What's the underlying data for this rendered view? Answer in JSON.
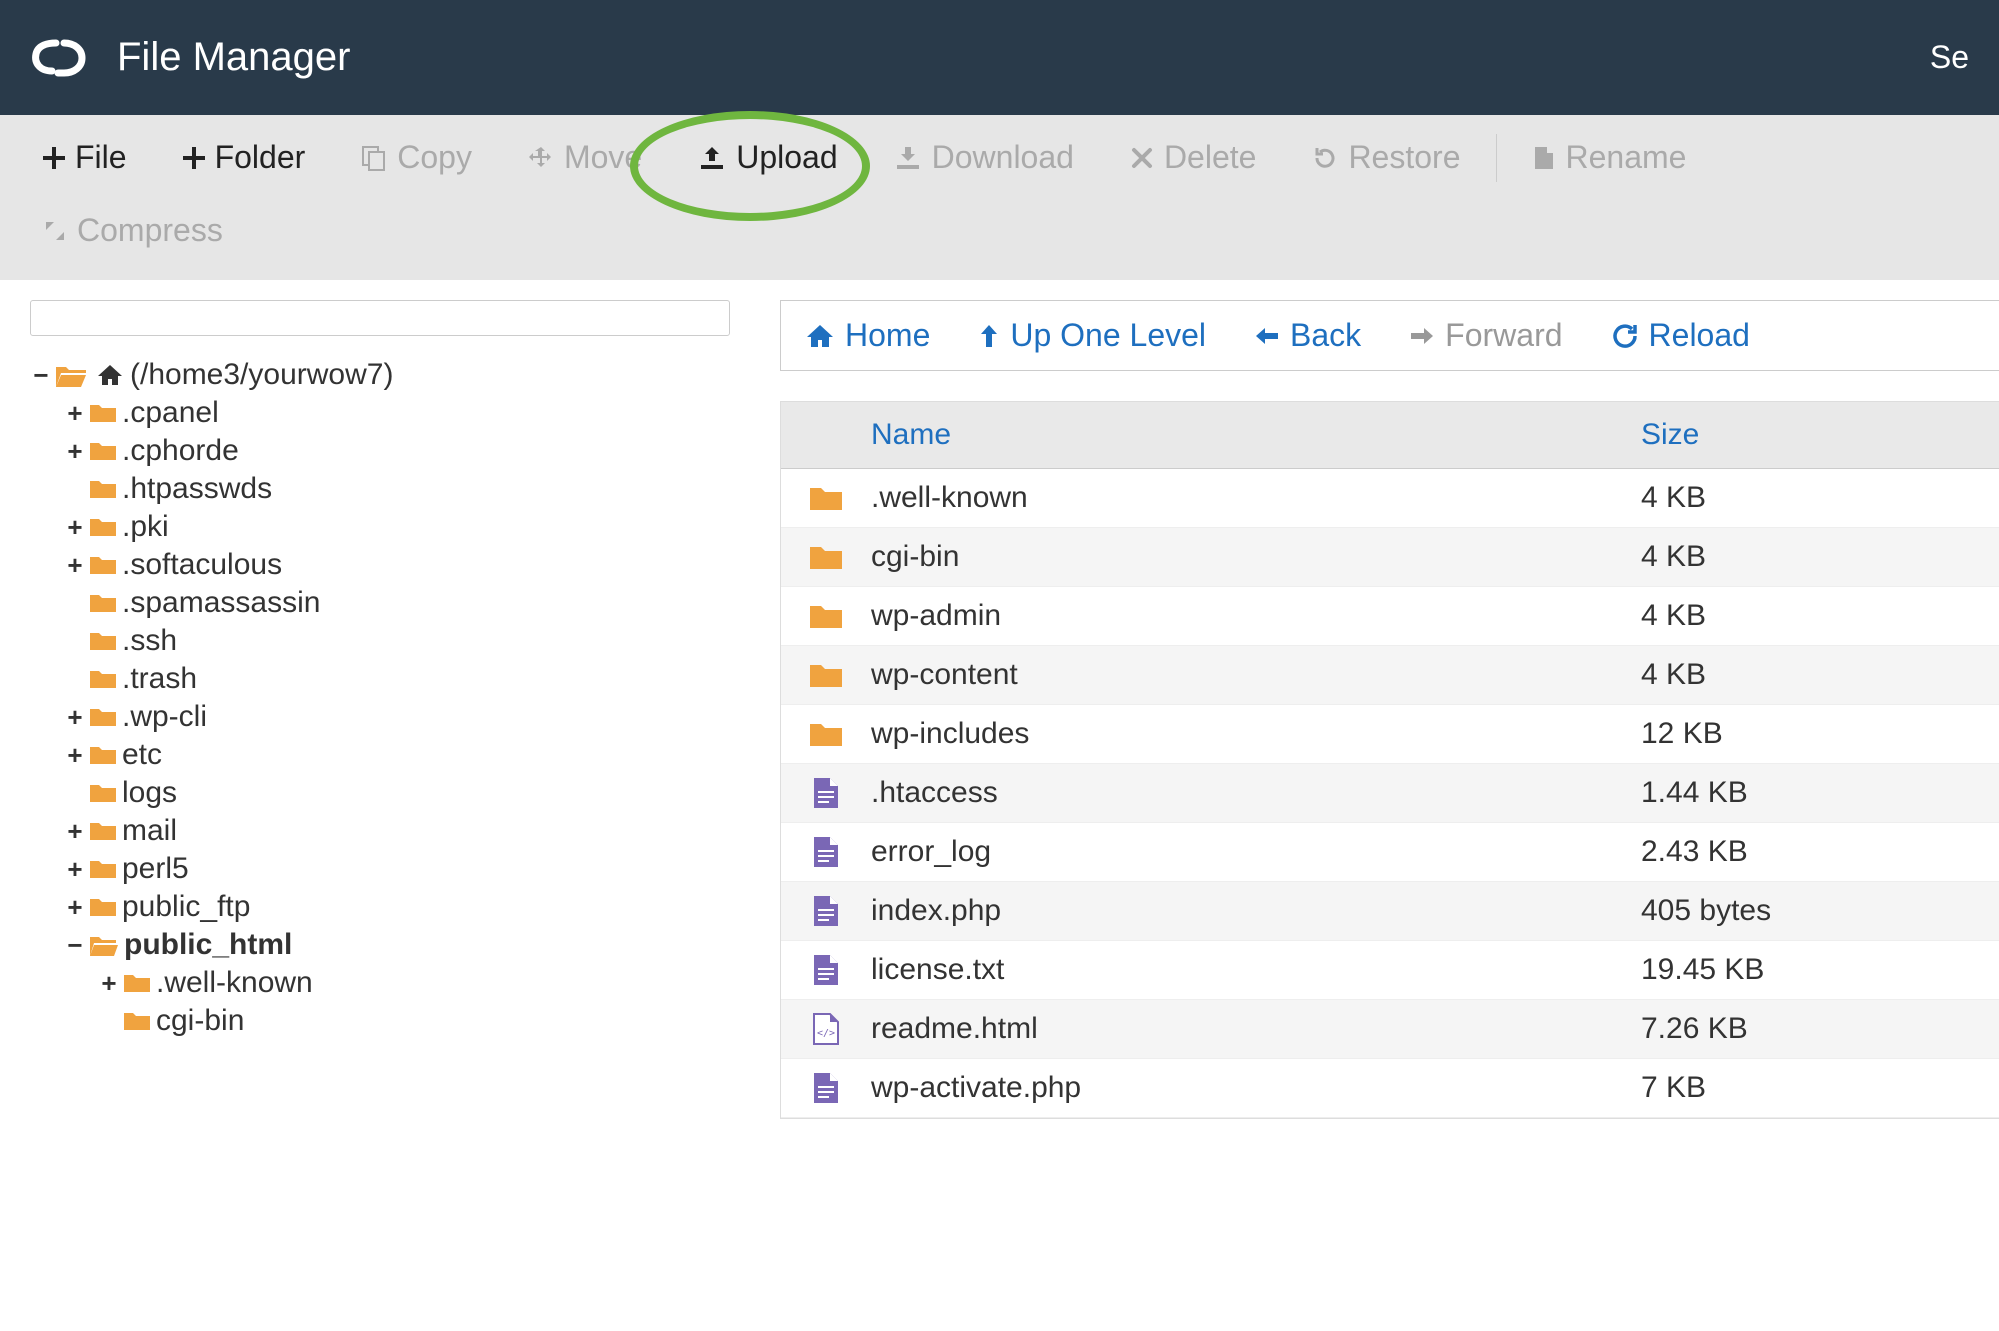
{
  "header": {
    "app_title": "File Manager",
    "right_text": "Se"
  },
  "toolbar": {
    "file": "File",
    "folder": "Folder",
    "copy": "Copy",
    "move": "Move",
    "upload": "Upload",
    "download": "Download",
    "delete": "Delete",
    "restore": "Restore",
    "rename": "Rename",
    "compress": "Compress"
  },
  "tree": {
    "root_label": "(/home3/yourwow7)",
    "items": [
      {
        "toggle": "+",
        "label": ".cpanel"
      },
      {
        "toggle": "+",
        "label": ".cphorde"
      },
      {
        "toggle": "",
        "label": ".htpasswds"
      },
      {
        "toggle": "+",
        "label": ".pki"
      },
      {
        "toggle": "+",
        "label": ".softaculous"
      },
      {
        "toggle": "",
        "label": ".spamassassin"
      },
      {
        "toggle": "",
        "label": ".ssh"
      },
      {
        "toggle": "",
        "label": ".trash"
      },
      {
        "toggle": "+",
        "label": ".wp-cli"
      },
      {
        "toggle": "+",
        "label": "etc"
      },
      {
        "toggle": "",
        "label": "logs"
      },
      {
        "toggle": "+",
        "label": "mail"
      },
      {
        "toggle": "+",
        "label": "perl5"
      },
      {
        "toggle": "+",
        "label": "public_ftp"
      }
    ],
    "public_html": {
      "toggle": "−",
      "label": "public_html",
      "children": [
        {
          "toggle": "+",
          "label": ".well-known"
        },
        {
          "toggle": "",
          "label": "cgi-bin"
        }
      ]
    }
  },
  "nav": {
    "home": "Home",
    "up": "Up One Level",
    "back": "Back",
    "forward": "Forward",
    "reload": "Reload"
  },
  "table": {
    "headers": {
      "name": "Name",
      "size": "Size"
    },
    "rows": [
      {
        "type": "folder",
        "name": ".well-known",
        "size": "4 KB"
      },
      {
        "type": "folder",
        "name": "cgi-bin",
        "size": "4 KB"
      },
      {
        "type": "folder",
        "name": "wp-admin",
        "size": "4 KB"
      },
      {
        "type": "folder",
        "name": "wp-content",
        "size": "4 KB"
      },
      {
        "type": "folder",
        "name": "wp-includes",
        "size": "12 KB"
      },
      {
        "type": "file",
        "name": ".htaccess",
        "size": "1.44 KB"
      },
      {
        "type": "file",
        "name": "error_log",
        "size": "2.43 KB"
      },
      {
        "type": "file",
        "name": "index.php",
        "size": "405 bytes"
      },
      {
        "type": "file",
        "name": "license.txt",
        "size": "19.45 KB"
      },
      {
        "type": "html",
        "name": "readme.html",
        "size": "7.26 KB"
      },
      {
        "type": "file",
        "name": "wp-activate.php",
        "size": "7 KB"
      }
    ]
  }
}
